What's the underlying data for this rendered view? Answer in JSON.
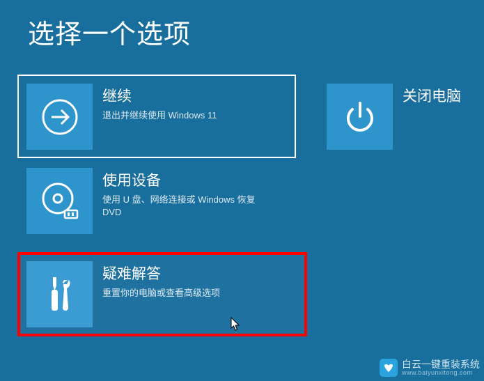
{
  "heading": "选择一个选项",
  "continue": {
    "title": "继续",
    "subtitle": "退出并继续使用 Windows 11",
    "icon": "arrow-right-icon"
  },
  "shutdown": {
    "title": "关闭电脑",
    "icon": "power-icon"
  },
  "use_device": {
    "title": "使用设备",
    "subtitle": "使用 U 盘、网络连接或 Windows 恢复 DVD",
    "icon": "disc-usb-icon"
  },
  "troubleshoot": {
    "title": "疑难解答",
    "subtitle": "重置你的电脑或查看高级选项",
    "icon": "tools-icon"
  },
  "watermark": {
    "brand": "白云一键重装系统",
    "url": "www.baiyunxitong.com"
  },
  "colors": {
    "bg": "#186E9D",
    "tile": "#2E94CC",
    "highlight_border": "#FF0000",
    "selected_border": "#FFFFFF"
  }
}
